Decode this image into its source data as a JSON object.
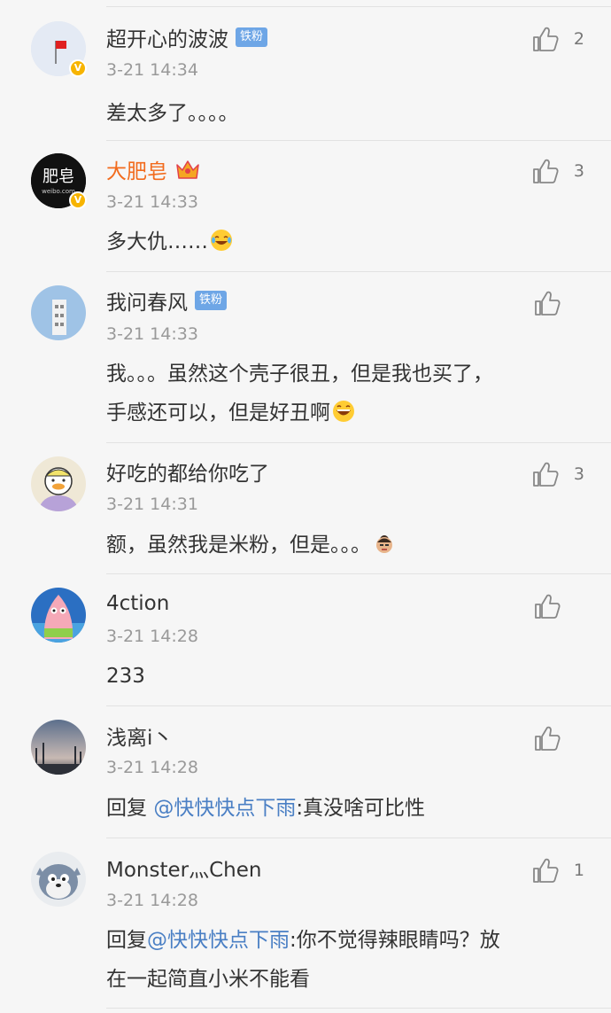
{
  "comments": [
    {
      "name": "超开心的波波",
      "badge": "铁粉",
      "time": "3-21 14:34",
      "text": "差太多了。。。。",
      "likes": "2"
    },
    {
      "name": "大肥皂",
      "time": "3-21 14:33",
      "text": "多大仇……",
      "likes": "3",
      "avatar_text": "肥皂",
      "avatar_sub": "weibo.com"
    },
    {
      "name": "我问春风",
      "badge": "铁粉",
      "time": "3-21 14:33",
      "text_line1": "我。。。虽然这个壳子很丑，但是我也买了，",
      "text_line2": "手感还可以，但是好丑啊",
      "likes": ""
    },
    {
      "name": "好吃的都给你吃了",
      "time": "3-21 14:31",
      "text": "额，虽然我是米粉，但是。。。",
      "likes": "3"
    },
    {
      "name": "4ction",
      "time": "3-21 14:28",
      "text": "233",
      "likes": ""
    },
    {
      "name": "浅离i丶",
      "time": "3-21 14:28",
      "reply_prefix": "回复 ",
      "mention": "@快快快点下雨",
      "text": ":真没啥可比性",
      "likes": ""
    },
    {
      "name": "Monster灬Chen",
      "time": "3-21 14:28",
      "reply_prefix": "回复",
      "mention": "@快快快点下雨",
      "text_line1": ":你不觉得辣眼睛吗？放",
      "text_line2": "在一起简直小米不能看",
      "likes": "1"
    }
  ],
  "icons": {
    "like": "thumbs-up-icon",
    "verified": "verified-v-icon",
    "crown": "crown-icon",
    "laugh_cry": "laugh-cry-emoji",
    "grin": "grin-emoji",
    "face": "face-emoji"
  },
  "colors": {
    "background": "#f6f6f6",
    "vip_name": "#f26b1d",
    "mention": "#4a7fc4",
    "tiefen_badge": "#6ea6e6",
    "verified_badge": "#f7b400",
    "time": "#999999"
  }
}
